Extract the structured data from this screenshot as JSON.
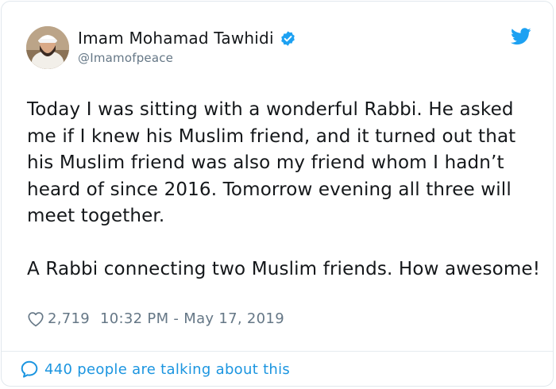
{
  "tweet": {
    "author": {
      "display_name": "Imam Mohamad Tawhidi",
      "handle": "@Imamofpeace"
    },
    "text": "Today I was sitting with a wonderful Rabbi. He asked me if I knew his Muslim friend, and it turned out that his Muslim friend was also my friend whom I hadn’t heard of since 2016. Tomorrow evening all three will meet together.\n\nA Rabbi connecting two Muslim friends. How awesome!",
    "likes": "2,719",
    "timestamp": "10:32 PM - May 17, 2019",
    "footer_text": "440 people are talking about this"
  },
  "colors": {
    "accent": "#1da1f2",
    "link": "#1b95e0",
    "muted": "#657786",
    "text": "#14171a"
  },
  "icons": {
    "avatar": "avatar",
    "verified": "verified-badge-icon",
    "brand": "twitter-bird-icon",
    "like": "heart-icon",
    "reply": "speech-bubble-icon"
  }
}
